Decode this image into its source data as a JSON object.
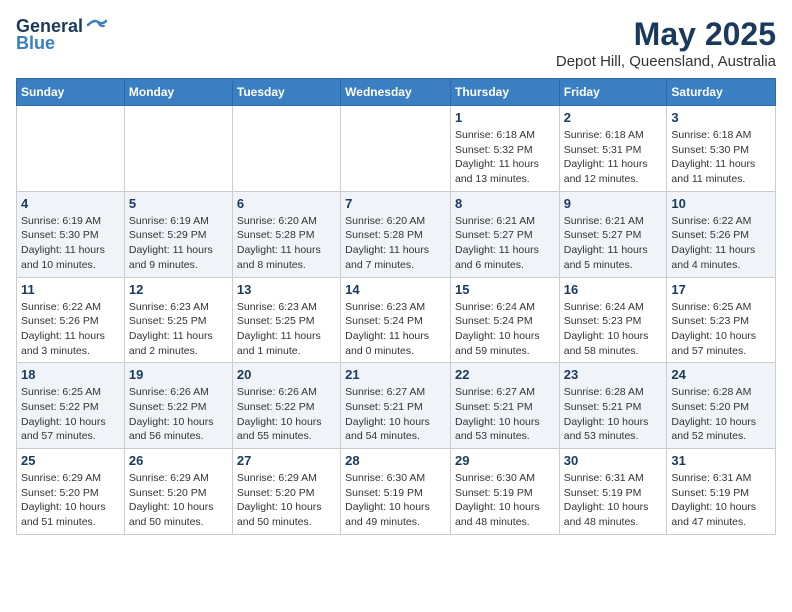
{
  "logo": {
    "general": "General",
    "blue": "Blue"
  },
  "title": "May 2025",
  "subtitle": "Depot Hill, Queensland, Australia",
  "days_of_week": [
    "Sunday",
    "Monday",
    "Tuesday",
    "Wednesday",
    "Thursday",
    "Friday",
    "Saturday"
  ],
  "weeks": [
    [
      {
        "day": "",
        "info": ""
      },
      {
        "day": "",
        "info": ""
      },
      {
        "day": "",
        "info": ""
      },
      {
        "day": "",
        "info": ""
      },
      {
        "day": "1",
        "info": "Sunrise: 6:18 AM\nSunset: 5:32 PM\nDaylight: 11 hours and 13 minutes."
      },
      {
        "day": "2",
        "info": "Sunrise: 6:18 AM\nSunset: 5:31 PM\nDaylight: 11 hours and 12 minutes."
      },
      {
        "day": "3",
        "info": "Sunrise: 6:18 AM\nSunset: 5:30 PM\nDaylight: 11 hours and 11 minutes."
      }
    ],
    [
      {
        "day": "4",
        "info": "Sunrise: 6:19 AM\nSunset: 5:30 PM\nDaylight: 11 hours and 10 minutes."
      },
      {
        "day": "5",
        "info": "Sunrise: 6:19 AM\nSunset: 5:29 PM\nDaylight: 11 hours and 9 minutes."
      },
      {
        "day": "6",
        "info": "Sunrise: 6:20 AM\nSunset: 5:28 PM\nDaylight: 11 hours and 8 minutes."
      },
      {
        "day": "7",
        "info": "Sunrise: 6:20 AM\nSunset: 5:28 PM\nDaylight: 11 hours and 7 minutes."
      },
      {
        "day": "8",
        "info": "Sunrise: 6:21 AM\nSunset: 5:27 PM\nDaylight: 11 hours and 6 minutes."
      },
      {
        "day": "9",
        "info": "Sunrise: 6:21 AM\nSunset: 5:27 PM\nDaylight: 11 hours and 5 minutes."
      },
      {
        "day": "10",
        "info": "Sunrise: 6:22 AM\nSunset: 5:26 PM\nDaylight: 11 hours and 4 minutes."
      }
    ],
    [
      {
        "day": "11",
        "info": "Sunrise: 6:22 AM\nSunset: 5:26 PM\nDaylight: 11 hours and 3 minutes."
      },
      {
        "day": "12",
        "info": "Sunrise: 6:23 AM\nSunset: 5:25 PM\nDaylight: 11 hours and 2 minutes."
      },
      {
        "day": "13",
        "info": "Sunrise: 6:23 AM\nSunset: 5:25 PM\nDaylight: 11 hours and 1 minute."
      },
      {
        "day": "14",
        "info": "Sunrise: 6:23 AM\nSunset: 5:24 PM\nDaylight: 11 hours and 0 minutes."
      },
      {
        "day": "15",
        "info": "Sunrise: 6:24 AM\nSunset: 5:24 PM\nDaylight: 10 hours and 59 minutes."
      },
      {
        "day": "16",
        "info": "Sunrise: 6:24 AM\nSunset: 5:23 PM\nDaylight: 10 hours and 58 minutes."
      },
      {
        "day": "17",
        "info": "Sunrise: 6:25 AM\nSunset: 5:23 PM\nDaylight: 10 hours and 57 minutes."
      }
    ],
    [
      {
        "day": "18",
        "info": "Sunrise: 6:25 AM\nSunset: 5:22 PM\nDaylight: 10 hours and 57 minutes."
      },
      {
        "day": "19",
        "info": "Sunrise: 6:26 AM\nSunset: 5:22 PM\nDaylight: 10 hours and 56 minutes."
      },
      {
        "day": "20",
        "info": "Sunrise: 6:26 AM\nSunset: 5:22 PM\nDaylight: 10 hours and 55 minutes."
      },
      {
        "day": "21",
        "info": "Sunrise: 6:27 AM\nSunset: 5:21 PM\nDaylight: 10 hours and 54 minutes."
      },
      {
        "day": "22",
        "info": "Sunrise: 6:27 AM\nSunset: 5:21 PM\nDaylight: 10 hours and 53 minutes."
      },
      {
        "day": "23",
        "info": "Sunrise: 6:28 AM\nSunset: 5:21 PM\nDaylight: 10 hours and 53 minutes."
      },
      {
        "day": "24",
        "info": "Sunrise: 6:28 AM\nSunset: 5:20 PM\nDaylight: 10 hours and 52 minutes."
      }
    ],
    [
      {
        "day": "25",
        "info": "Sunrise: 6:29 AM\nSunset: 5:20 PM\nDaylight: 10 hours and 51 minutes."
      },
      {
        "day": "26",
        "info": "Sunrise: 6:29 AM\nSunset: 5:20 PM\nDaylight: 10 hours and 50 minutes."
      },
      {
        "day": "27",
        "info": "Sunrise: 6:29 AM\nSunset: 5:20 PM\nDaylight: 10 hours and 50 minutes."
      },
      {
        "day": "28",
        "info": "Sunrise: 6:30 AM\nSunset: 5:19 PM\nDaylight: 10 hours and 49 minutes."
      },
      {
        "day": "29",
        "info": "Sunrise: 6:30 AM\nSunset: 5:19 PM\nDaylight: 10 hours and 48 minutes."
      },
      {
        "day": "30",
        "info": "Sunrise: 6:31 AM\nSunset: 5:19 PM\nDaylight: 10 hours and 48 minutes."
      },
      {
        "day": "31",
        "info": "Sunrise: 6:31 AM\nSunset: 5:19 PM\nDaylight: 10 hours and 47 minutes."
      }
    ]
  ]
}
